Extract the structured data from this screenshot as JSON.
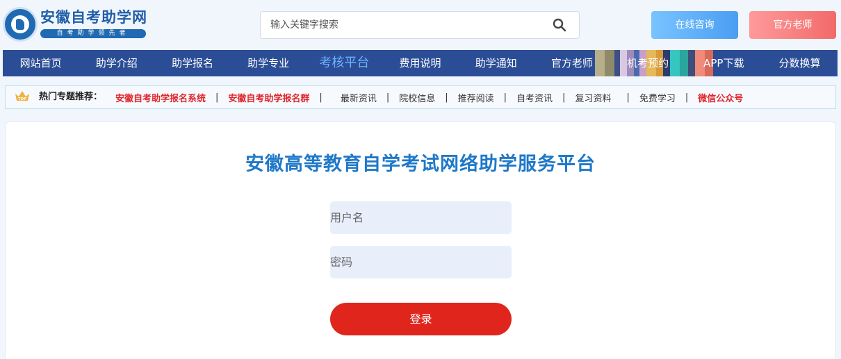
{
  "header": {
    "logo_title": "安徽自考助学网",
    "logo_slogan": "自考助学领先者",
    "search_placeholder": "输入关键字搜索",
    "consult_label": "在线咨询",
    "teacher_label": "官方老师"
  },
  "nav": {
    "items": [
      {
        "label": "网站首页"
      },
      {
        "label": "助学介绍"
      },
      {
        "label": "助学报名"
      },
      {
        "label": "助学专业"
      },
      {
        "label": "考核平台",
        "active": true
      },
      {
        "label": "费用说明"
      },
      {
        "label": "助学通知"
      },
      {
        "label": "官方老师"
      },
      {
        "label": "机考预约"
      },
      {
        "label": "APP下载"
      },
      {
        "label": "分数换算"
      }
    ],
    "colors": {
      "background": "#2b4d96",
      "active": "#6fb3ff"
    }
  },
  "hotbar": {
    "badge": "TOP",
    "label": "热门专题推荐：",
    "links": [
      {
        "label": "安徽自考助学报名系统",
        "red": true
      },
      {
        "label": "安徽自考助学报名群",
        "red": true
      },
      {
        "label": "最新资讯"
      },
      {
        "label": "院校信息"
      },
      {
        "label": "推荐阅读"
      },
      {
        "label": "自考资讯"
      },
      {
        "label": "复习资料"
      },
      {
        "label": "免费学习"
      },
      {
        "label": "微信公众号",
        "red": true
      }
    ]
  },
  "login": {
    "title": "安徽高等教育自学考试网络助学服务平台",
    "username_placeholder": "用户名",
    "password_placeholder": "密码",
    "submit_label": "登录"
  },
  "colors": {
    "brand_blue": "#1f78c8",
    "login_red": "#e0261c",
    "link_red": "#e0262c"
  }
}
